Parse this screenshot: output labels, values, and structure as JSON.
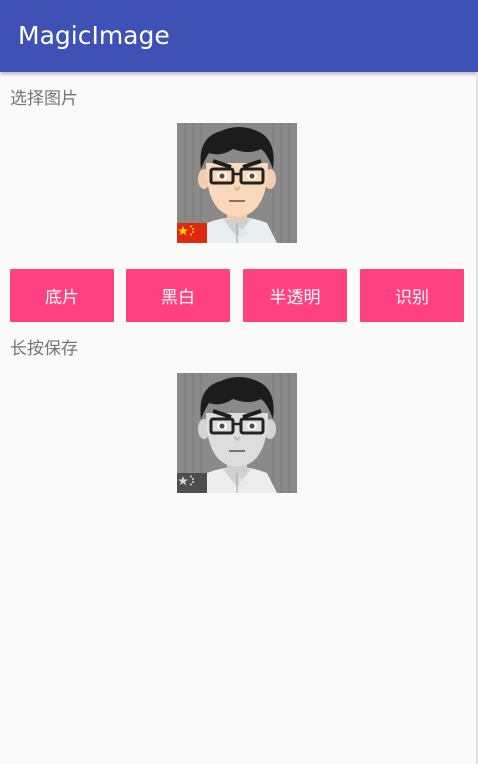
{
  "app": {
    "title": "MagicImage"
  },
  "colors": {
    "appbar": "#3f51b5",
    "accent": "#ff4081",
    "background": "#fafafa"
  },
  "select_label": "选择图片",
  "buttons": {
    "negative": "底片",
    "black_white": "黑白",
    "translucent": "半透明",
    "recognize": "识别"
  },
  "save_label": "长按保存"
}
